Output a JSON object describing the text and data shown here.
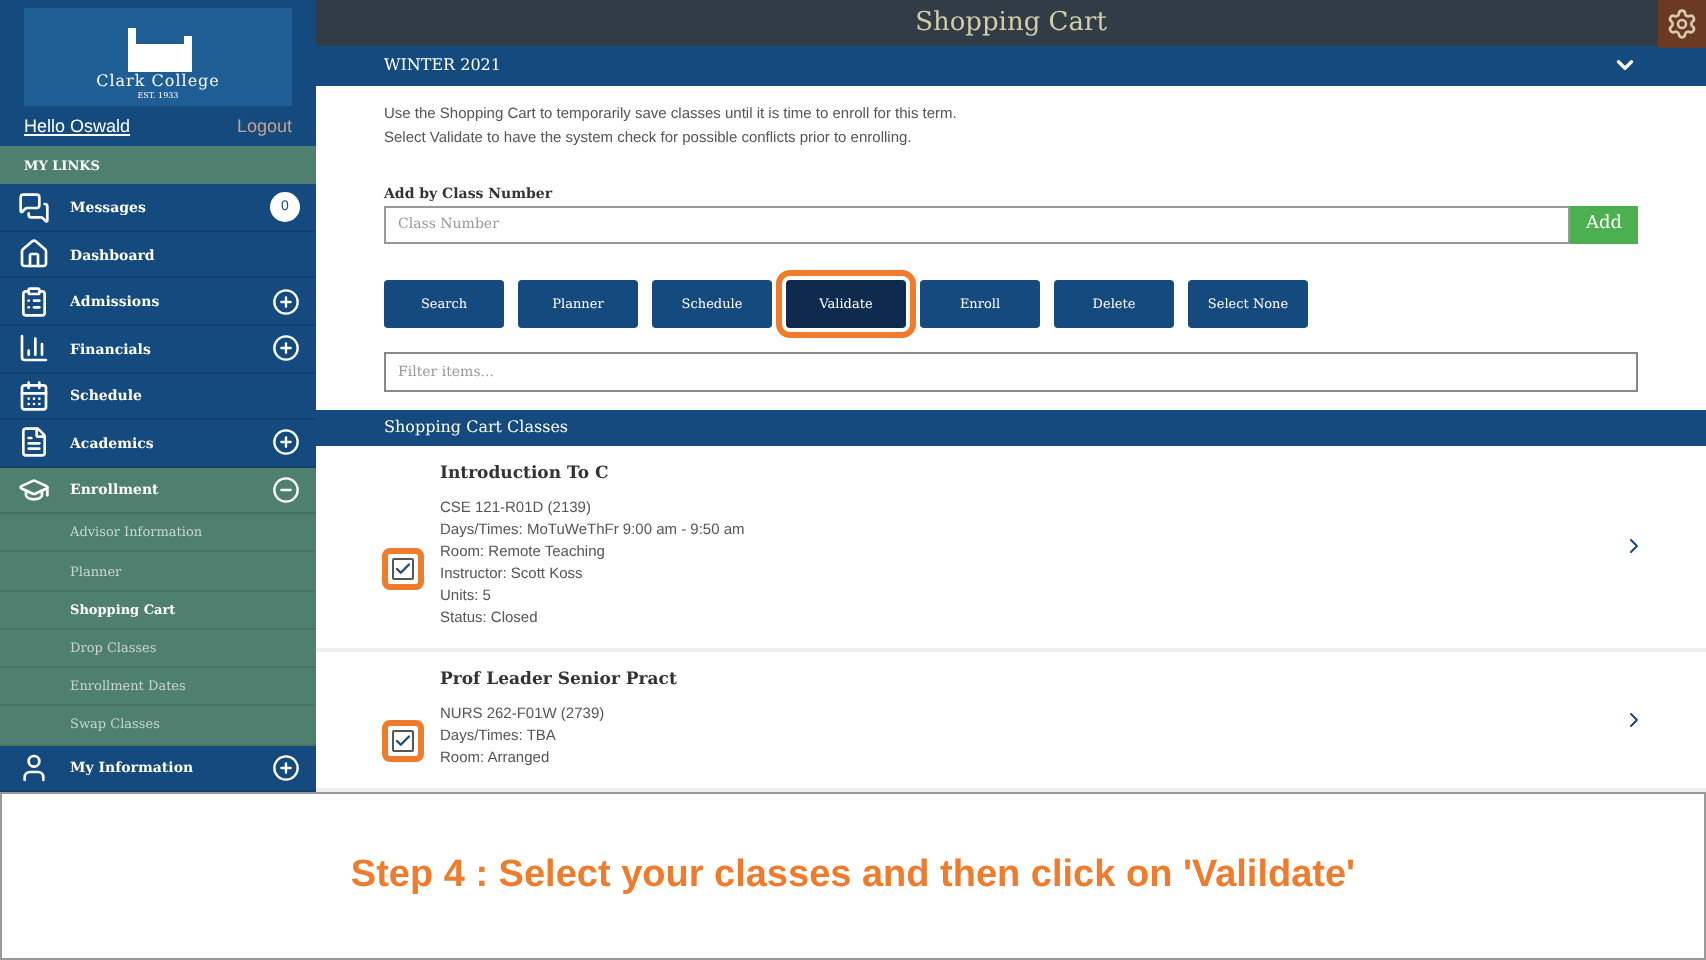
{
  "sidebar": {
    "logo": {
      "name": "Clark College",
      "established": "EST. 1933"
    },
    "greeting": "Hello Oswald",
    "logout": "Logout",
    "section_title": "MY LINKS",
    "items": [
      {
        "label": "Messages",
        "count": "0",
        "expandable": false,
        "expanded": false
      },
      {
        "label": "Dashboard",
        "expandable": false,
        "expanded": false
      },
      {
        "label": "Admissions",
        "expandable": true,
        "expanded": false
      },
      {
        "label": "Financials",
        "expandable": true,
        "expanded": false
      },
      {
        "label": "Schedule",
        "expandable": false,
        "expanded": false
      },
      {
        "label": "Academics",
        "expandable": true,
        "expanded": false
      },
      {
        "label": "Enrollment",
        "expandable": true,
        "expanded": true,
        "children": [
          {
            "label": "Advisor Information",
            "selected": false
          },
          {
            "label": "Planner",
            "selected": false
          },
          {
            "label": "Shopping Cart",
            "selected": true
          },
          {
            "label": "Drop Classes",
            "selected": false
          },
          {
            "label": "Enrollment Dates",
            "selected": false
          },
          {
            "label": "Swap Classes",
            "selected": false
          }
        ]
      },
      {
        "label": "My Information",
        "expandable": true,
        "expanded": false
      }
    ]
  },
  "header": {
    "title": "Shopping Cart"
  },
  "term": {
    "label": "WINTER 2021",
    "expanded": true
  },
  "description": [
    "Use the Shopping Cart to temporarily save classes until it is time to enroll for this term.",
    "Select Validate to have the system check for possible conflicts prior to enrolling."
  ],
  "add_by_class": {
    "label": "Add by Class Number",
    "placeholder": "Class Number",
    "button": "Add"
  },
  "actions": [
    {
      "label": "Search",
      "highlighted": false
    },
    {
      "label": "Planner",
      "highlighted": false
    },
    {
      "label": "Schedule",
      "highlighted": false
    },
    {
      "label": "Validate",
      "highlighted": true
    },
    {
      "label": "Enroll",
      "highlighted": false
    },
    {
      "label": "Delete",
      "highlighted": false
    },
    {
      "label": "Select None",
      "highlighted": false
    }
  ],
  "filter": {
    "placeholder": "Filter items..."
  },
  "classes_section": {
    "title": "Shopping Cart Classes"
  },
  "classes": [
    {
      "title": "Introduction To C",
      "checked": true,
      "highlighted": true,
      "details": [
        "CSE 121-R01D (2139)",
        "Days/Times:  MoTuWeThFr 9:00 am - 9:50 am",
        "Room:  Remote Teaching",
        "Instructor: Scott Koss",
        "Units: 5",
        "Status: Closed"
      ]
    },
    {
      "title": "Prof Leader Senior Pract",
      "checked": true,
      "highlighted": true,
      "details": [
        "NURS 262-F01W (2739)",
        "Days/Times:  TBA",
        "Room:  Arranged"
      ]
    }
  ],
  "caption": "Step 4 : Select your classes and then click on 'Valildate'"
}
